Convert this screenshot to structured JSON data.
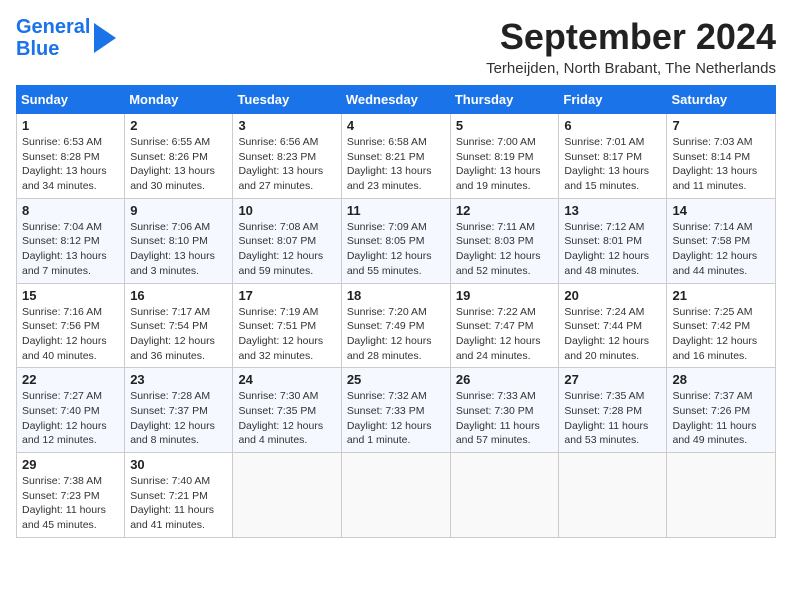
{
  "header": {
    "logo_line1": "General",
    "logo_line2": "Blue",
    "month_title": "September 2024",
    "subtitle": "Terheijden, North Brabant, The Netherlands"
  },
  "days_of_week": [
    "Sunday",
    "Monday",
    "Tuesday",
    "Wednesday",
    "Thursday",
    "Friday",
    "Saturday"
  ],
  "weeks": [
    [
      {
        "day": "1",
        "info": "Sunrise: 6:53 AM\nSunset: 8:28 PM\nDaylight: 13 hours\nand 34 minutes."
      },
      {
        "day": "2",
        "info": "Sunrise: 6:55 AM\nSunset: 8:26 PM\nDaylight: 13 hours\nand 30 minutes."
      },
      {
        "day": "3",
        "info": "Sunrise: 6:56 AM\nSunset: 8:23 PM\nDaylight: 13 hours\nand 27 minutes."
      },
      {
        "day": "4",
        "info": "Sunrise: 6:58 AM\nSunset: 8:21 PM\nDaylight: 13 hours\nand 23 minutes."
      },
      {
        "day": "5",
        "info": "Sunrise: 7:00 AM\nSunset: 8:19 PM\nDaylight: 13 hours\nand 19 minutes."
      },
      {
        "day": "6",
        "info": "Sunrise: 7:01 AM\nSunset: 8:17 PM\nDaylight: 13 hours\nand 15 minutes."
      },
      {
        "day": "7",
        "info": "Sunrise: 7:03 AM\nSunset: 8:14 PM\nDaylight: 13 hours\nand 11 minutes."
      }
    ],
    [
      {
        "day": "8",
        "info": "Sunrise: 7:04 AM\nSunset: 8:12 PM\nDaylight: 13 hours\nand 7 minutes."
      },
      {
        "day": "9",
        "info": "Sunrise: 7:06 AM\nSunset: 8:10 PM\nDaylight: 13 hours\nand 3 minutes."
      },
      {
        "day": "10",
        "info": "Sunrise: 7:08 AM\nSunset: 8:07 PM\nDaylight: 12 hours\nand 59 minutes."
      },
      {
        "day": "11",
        "info": "Sunrise: 7:09 AM\nSunset: 8:05 PM\nDaylight: 12 hours\nand 55 minutes."
      },
      {
        "day": "12",
        "info": "Sunrise: 7:11 AM\nSunset: 8:03 PM\nDaylight: 12 hours\nand 52 minutes."
      },
      {
        "day": "13",
        "info": "Sunrise: 7:12 AM\nSunset: 8:01 PM\nDaylight: 12 hours\nand 48 minutes."
      },
      {
        "day": "14",
        "info": "Sunrise: 7:14 AM\nSunset: 7:58 PM\nDaylight: 12 hours\nand 44 minutes."
      }
    ],
    [
      {
        "day": "15",
        "info": "Sunrise: 7:16 AM\nSunset: 7:56 PM\nDaylight: 12 hours\nand 40 minutes."
      },
      {
        "day": "16",
        "info": "Sunrise: 7:17 AM\nSunset: 7:54 PM\nDaylight: 12 hours\nand 36 minutes."
      },
      {
        "day": "17",
        "info": "Sunrise: 7:19 AM\nSunset: 7:51 PM\nDaylight: 12 hours\nand 32 minutes."
      },
      {
        "day": "18",
        "info": "Sunrise: 7:20 AM\nSunset: 7:49 PM\nDaylight: 12 hours\nand 28 minutes."
      },
      {
        "day": "19",
        "info": "Sunrise: 7:22 AM\nSunset: 7:47 PM\nDaylight: 12 hours\nand 24 minutes."
      },
      {
        "day": "20",
        "info": "Sunrise: 7:24 AM\nSunset: 7:44 PM\nDaylight: 12 hours\nand 20 minutes."
      },
      {
        "day": "21",
        "info": "Sunrise: 7:25 AM\nSunset: 7:42 PM\nDaylight: 12 hours\nand 16 minutes."
      }
    ],
    [
      {
        "day": "22",
        "info": "Sunrise: 7:27 AM\nSunset: 7:40 PM\nDaylight: 12 hours\nand 12 minutes."
      },
      {
        "day": "23",
        "info": "Sunrise: 7:28 AM\nSunset: 7:37 PM\nDaylight: 12 hours\nand 8 minutes."
      },
      {
        "day": "24",
        "info": "Sunrise: 7:30 AM\nSunset: 7:35 PM\nDaylight: 12 hours\nand 4 minutes."
      },
      {
        "day": "25",
        "info": "Sunrise: 7:32 AM\nSunset: 7:33 PM\nDaylight: 12 hours\nand 1 minute."
      },
      {
        "day": "26",
        "info": "Sunrise: 7:33 AM\nSunset: 7:30 PM\nDaylight: 11 hours\nand 57 minutes."
      },
      {
        "day": "27",
        "info": "Sunrise: 7:35 AM\nSunset: 7:28 PM\nDaylight: 11 hours\nand 53 minutes."
      },
      {
        "day": "28",
        "info": "Sunrise: 7:37 AM\nSunset: 7:26 PM\nDaylight: 11 hours\nand 49 minutes."
      }
    ],
    [
      {
        "day": "29",
        "info": "Sunrise: 7:38 AM\nSunset: 7:23 PM\nDaylight: 11 hours\nand 45 minutes."
      },
      {
        "day": "30",
        "info": "Sunrise: 7:40 AM\nSunset: 7:21 PM\nDaylight: 11 hours\nand 41 minutes."
      },
      {
        "day": "",
        "info": ""
      },
      {
        "day": "",
        "info": ""
      },
      {
        "day": "",
        "info": ""
      },
      {
        "day": "",
        "info": ""
      },
      {
        "day": "",
        "info": ""
      }
    ]
  ]
}
